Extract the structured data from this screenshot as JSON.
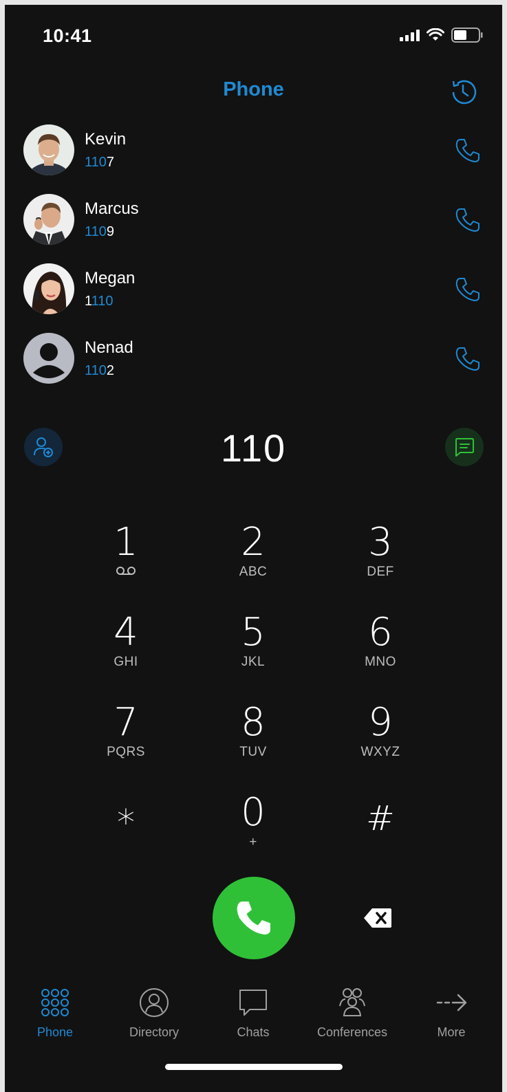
{
  "status_bar": {
    "time": "10:41"
  },
  "header": {
    "title": "Phone"
  },
  "contacts": [
    {
      "name": "Kevin",
      "ext_highlight": "110",
      "ext_rest": "7",
      "ext_prefix": ""
    },
    {
      "name": "Marcus",
      "ext_highlight": "110",
      "ext_rest": "9",
      "ext_prefix": ""
    },
    {
      "name": "Megan",
      "ext_prefix": "1",
      "ext_highlight": "110",
      "ext_rest": ""
    },
    {
      "name": "Nenad",
      "ext_highlight": "110",
      "ext_rest": "2",
      "ext_prefix": ""
    }
  ],
  "dialer": {
    "number": "110"
  },
  "keypad": [
    {
      "digit": "1",
      "letters": ""
    },
    {
      "digit": "2",
      "letters": "ABC"
    },
    {
      "digit": "3",
      "letters": "DEF"
    },
    {
      "digit": "4",
      "letters": "GHI"
    },
    {
      "digit": "5",
      "letters": "JKL"
    },
    {
      "digit": "6",
      "letters": "MNO"
    },
    {
      "digit": "7",
      "letters": "PQRS"
    },
    {
      "digit": "8",
      "letters": "TUV"
    },
    {
      "digit": "9",
      "letters": "WXYZ"
    },
    {
      "digit": "*",
      "letters": ""
    },
    {
      "digit": "0",
      "letters": "+"
    },
    {
      "digit": "#",
      "letters": ""
    }
  ],
  "tabs": [
    {
      "label": "Phone",
      "icon": "keypad-grid-icon",
      "active": true
    },
    {
      "label": "Directory",
      "icon": "person-circle-icon",
      "active": false
    },
    {
      "label": "Chats",
      "icon": "chat-bubble-icon",
      "active": false
    },
    {
      "label": "Conferences",
      "icon": "group-icon",
      "active": false
    },
    {
      "label": "More",
      "icon": "arrow-right-icon",
      "active": false
    }
  ],
  "colors": {
    "accent": "#1f8ad3",
    "call_green": "#30c038",
    "background": "#121212"
  }
}
